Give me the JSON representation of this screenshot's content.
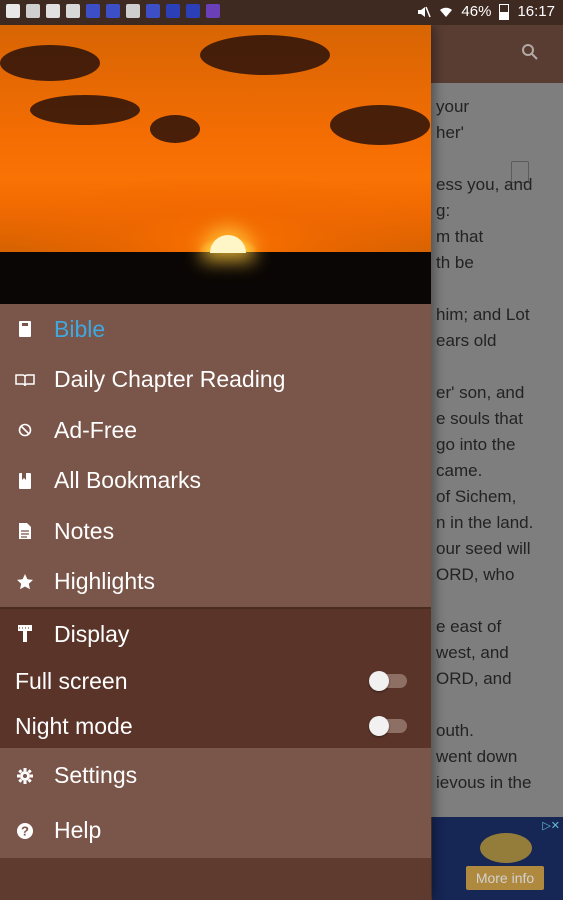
{
  "status_bar": {
    "battery": "46%",
    "time": "16:17",
    "notification_icons": [
      "mail-icon",
      "sim-icon",
      "dropbox-icon",
      "image-icon",
      "app-icon",
      "app-icon",
      "sim-icon",
      "app-icon",
      "download-icon",
      "download-icon",
      "download-icon"
    ]
  },
  "background": {
    "lines": [
      "your",
      "her'",
      "ess you, and",
      "g:",
      "m that",
      "th be",
      "him; and Lot",
      "ears old",
      "er' son, and",
      "e souls that",
      "go into the",
      "came.",
      "of Sichem,",
      "n in the land.",
      "our seed will",
      "ORD, who",
      "e east of",
      "west, and",
      "ORD, and",
      "outh.",
      "went down",
      "ievous in the"
    ],
    "ad_button": "More info"
  },
  "drawer": {
    "items": [
      {
        "label": "Bible",
        "icon": "book-icon",
        "active": true
      },
      {
        "label": "Daily Chapter Reading",
        "icon": "open-book-icon",
        "active": false
      },
      {
        "label": "Ad-Free",
        "icon": "block-icon",
        "active": false
      },
      {
        "label": "All Bookmarks",
        "icon": "bookmark-book-icon",
        "active": false
      },
      {
        "label": "Notes",
        "icon": "document-icon",
        "active": false
      },
      {
        "label": "Highlights",
        "icon": "star-icon",
        "active": false
      }
    ],
    "display": {
      "label": "Display",
      "icon": "paint-brush-icon",
      "toggles": [
        {
          "label": "Full screen",
          "on": false
        },
        {
          "label": "Night mode",
          "on": false
        }
      ]
    },
    "bottom_items": [
      {
        "label": "Settings",
        "icon": "gear-icon"
      },
      {
        "label": "Help",
        "icon": "help-icon"
      }
    ]
  },
  "colors": {
    "accent": "#3fa8e0",
    "drawer_bg": "#7a5549",
    "display_section_bg": "#5a3429"
  }
}
